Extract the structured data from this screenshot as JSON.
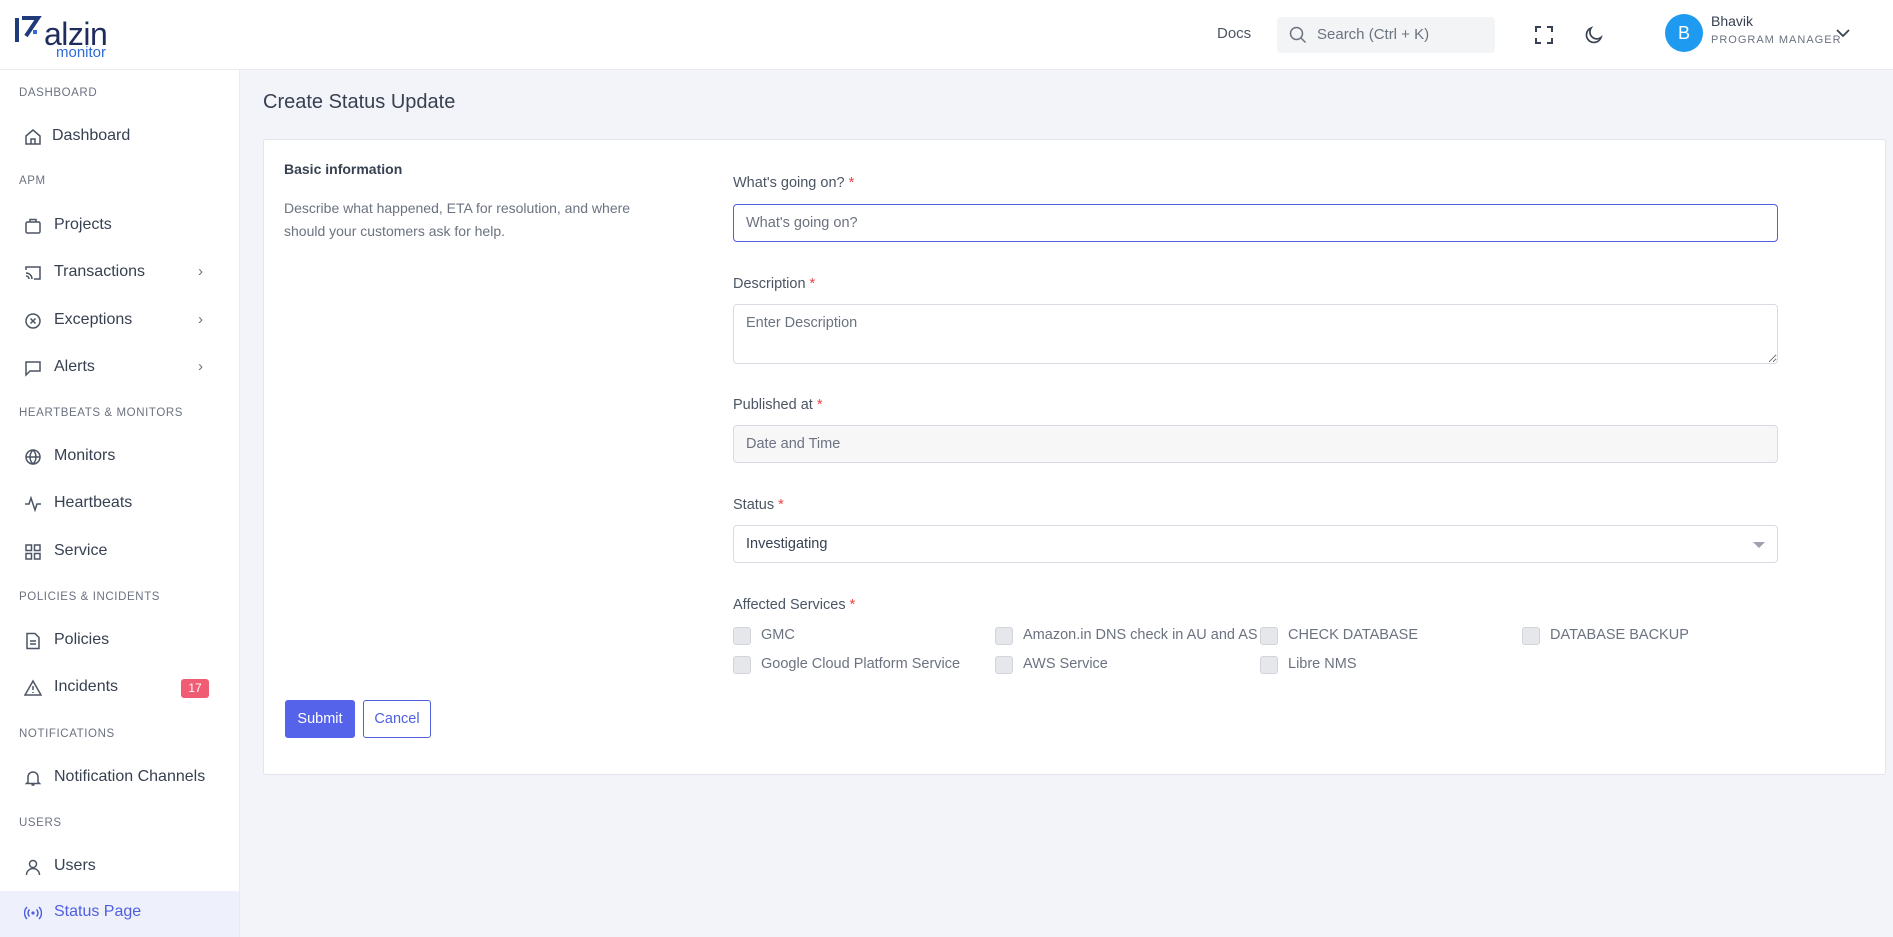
{
  "header": {
    "logo_word": "alzin",
    "logo_sub": "monitor",
    "docs_label": "Docs",
    "search_placeholder": "Search (Ctrl + K)",
    "user": {
      "initial": "B",
      "name": "Bhavik",
      "role": "PROGRAM MANAGER"
    }
  },
  "sidebar": {
    "sections": {
      "dashboard": "DASHBOARD",
      "apm": "APM",
      "heartbeats": "HEARTBEATS & MONITORS",
      "policies": "POLICIES & INCIDENTS",
      "notifications": "NOTIFICATIONS",
      "users": "USERS"
    },
    "items": {
      "dashboard": "Dashboard",
      "projects": "Projects",
      "transactions": "Transactions",
      "exceptions": "Exceptions",
      "alerts": "Alerts",
      "monitors": "Monitors",
      "heartbeats": "Heartbeats",
      "service": "Service",
      "policies": "Policies",
      "incidents": "Incidents",
      "incidents_badge": "17",
      "notification_channels": "Notification Channels",
      "users": "Users",
      "status_page": "Status Page"
    },
    "arrow": "›"
  },
  "page": {
    "title": "Create Status Update",
    "basic_title": "Basic information",
    "basic_desc": "Describe what happened, ETA for resolution, and where should your customers ask for help."
  },
  "form": {
    "req": "*",
    "whats_label": "What's going on?",
    "whats_placeholder": "What's going on?",
    "whats_value": "",
    "desc_label": "Description",
    "desc_placeholder": "Enter Description",
    "published_label": "Published at",
    "published_placeholder": "Date and Time",
    "status_label": "Status",
    "status_value": "Investigating",
    "affected_label": "Affected Services",
    "services": [
      "GMC",
      "Amazon.in DNS check in AU and AS",
      "CHECK DATABASE",
      "DATABASE BACKUP",
      "Google Cloud Platform Service",
      "AWS Service",
      "Libre NMS"
    ],
    "submit_label": "Submit",
    "cancel_label": "Cancel"
  },
  "colors": {
    "accent": "#4f5fe0",
    "badge": "#f05c73",
    "avatar": "#1e9bf0"
  }
}
